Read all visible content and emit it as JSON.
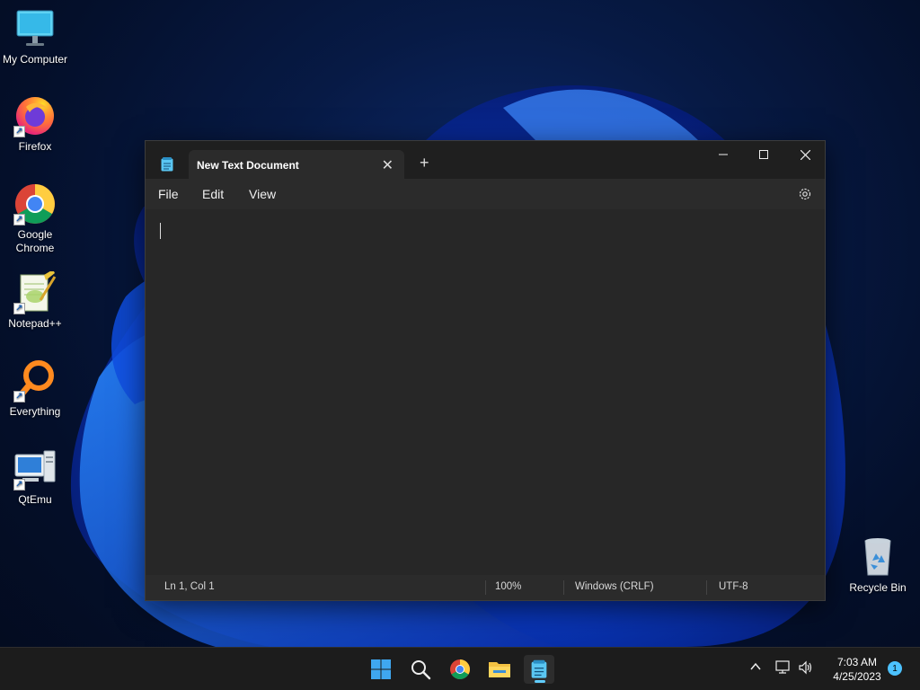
{
  "desktop": {
    "icons": [
      {
        "label": "My Computer",
        "icon": "monitor-icon"
      },
      {
        "label": "Firefox",
        "icon": "firefox-icon"
      },
      {
        "label": "Google Chrome",
        "icon": "chrome-icon"
      },
      {
        "label": "Notepad++",
        "icon": "notepadpp-icon"
      },
      {
        "label": "Everything",
        "icon": "magnifier-icon"
      },
      {
        "label": "QtEmu",
        "icon": "computer-tower-icon"
      }
    ],
    "recycle_bin": {
      "label": "Recycle Bin",
      "icon": "recycle-bin-icon"
    }
  },
  "notepad": {
    "tab_title": "New Text Document",
    "menu": [
      "File",
      "Edit",
      "View"
    ],
    "status": {
      "position": "Ln 1, Col 1",
      "zoom": "100%",
      "line_ending": "Windows (CRLF)",
      "encoding": "UTF-8"
    },
    "colors": {
      "background": "#272727",
      "titlebar": "#1f1f1f"
    }
  },
  "taskbar": {
    "apps": [
      "start-icon",
      "search-icon",
      "chrome-icon",
      "file-explorer-icon",
      "notepad-icon"
    ],
    "active_app": "notepad-icon",
    "clock_time": "7:03 AM",
    "clock_date": "4/25/2023",
    "notification_count": "1",
    "accent": "#60cdff"
  }
}
